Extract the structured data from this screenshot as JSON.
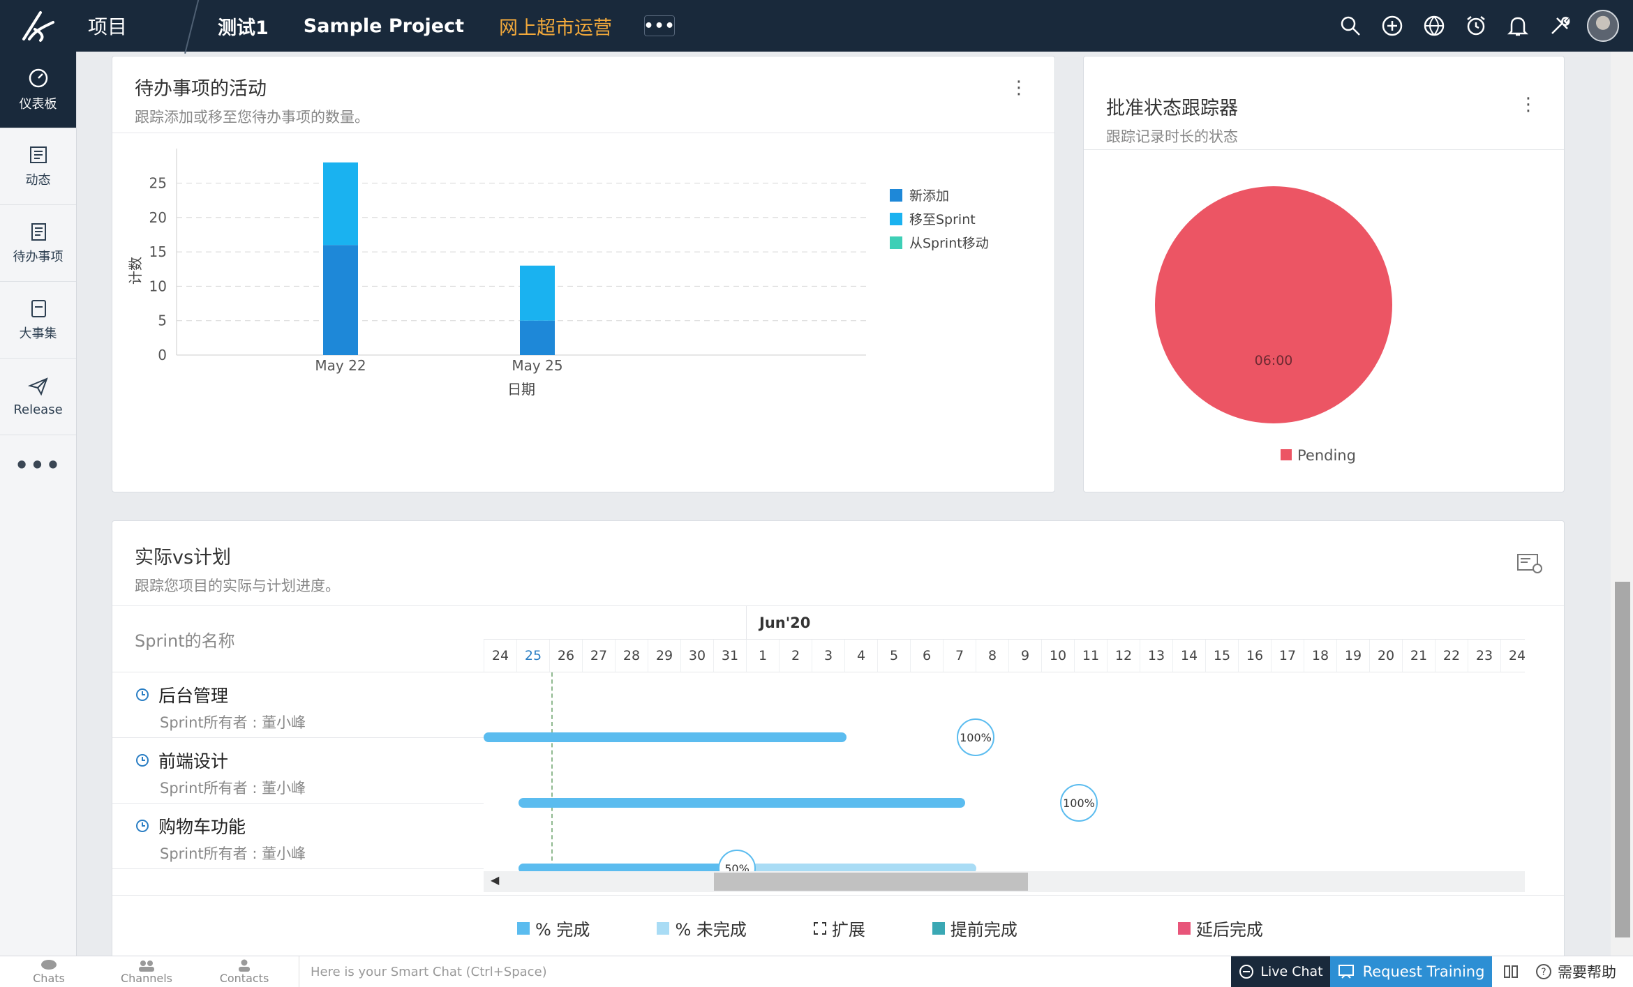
{
  "topbar": {
    "projects_label": "项目",
    "breadcrumbs": [
      "测试1",
      "Sample Project",
      "网上超市运营"
    ],
    "more_label": "•••"
  },
  "sidebar": {
    "items": [
      {
        "label": "仪表板",
        "icon": "dashboard-icon",
        "active": true
      },
      {
        "label": "动态",
        "icon": "feed-icon",
        "active": false
      },
      {
        "label": "待办事项",
        "icon": "backlog-icon",
        "active": false
      },
      {
        "label": "大事集",
        "icon": "epic-icon",
        "active": false
      },
      {
        "label": "Release",
        "icon": "release-icon",
        "active": false
      }
    ],
    "more_label": "•••"
  },
  "backlog_card": {
    "title": "待办事项的活动",
    "subtitle": "跟踪添加或移至您待办事项的数量。"
  },
  "approval_card": {
    "title": "批准状态跟踪器",
    "subtitle": "跟踪记录时长的状态"
  },
  "chart_data": [
    {
      "type": "bar",
      "stacked": true,
      "categories": [
        "May 22",
        "May 25"
      ],
      "series": [
        {
          "name": "新添加",
          "color": "#1e88d8",
          "values": [
            16,
            5
          ]
        },
        {
          "name": "移至Sprint",
          "color": "#1ab2f0",
          "values": [
            12,
            8
          ]
        },
        {
          "name": "从Sprint移动",
          "color": "#3ecfb6",
          "values": [
            0,
            0
          ]
        }
      ],
      "xlabel": "日期",
      "ylabel": "计数",
      "ylim": [
        0,
        29
      ],
      "yticks": [
        "0",
        "5",
        "10",
        "15",
        "20",
        "25"
      ],
      "grid": true,
      "legend": "right"
    },
    {
      "type": "pie",
      "slices": [
        {
          "name": "Pending",
          "value": 100,
          "label": "06:00",
          "color": "#ec5564"
        }
      ],
      "legend": "bottom"
    }
  ],
  "actual_vs_plan": {
    "title": "实际vs计划",
    "subtitle": "跟踪您项目的实际与计划进度。",
    "column_header": "Sprint的名称",
    "month_label": "Jun'20",
    "days": [
      "24",
      "25",
      "26",
      "27",
      "28",
      "29",
      "30",
      "31",
      "1",
      "2",
      "3",
      "4",
      "5",
      "6",
      "7",
      "8",
      "9",
      "10",
      "11",
      "12",
      "13",
      "14",
      "15",
      "16",
      "17",
      "18",
      "19",
      "20",
      "21",
      "22",
      "23",
      "24"
    ],
    "today_index": 1,
    "sprints": [
      {
        "name": "后台管理",
        "owner": "Sprint所有者 : 董小峰",
        "percent": 1.0,
        "percent_label": "100%"
      },
      {
        "name": "前端设计",
        "owner": "Sprint所有者 : 董小峰",
        "percent": 1.0,
        "percent_label": "100%"
      },
      {
        "name": "购物车功能",
        "owner": "Sprint所有者 : 董小峰",
        "percent": 0.5,
        "percent_label": "50%"
      }
    ],
    "legend": [
      {
        "label": "% 完成",
        "color": "#5bbcef",
        "style": "solid"
      },
      {
        "label": "% 未完成",
        "color": "#a9dcf5",
        "style": "solid"
      },
      {
        "label": "扩展",
        "color": "#333333",
        "style": "dashed"
      },
      {
        "label": "提前完成",
        "color": "#3aa8b4",
        "style": "solid"
      },
      {
        "label": "延后完成",
        "color": "#e8557a",
        "style": "solid"
      }
    ]
  },
  "bottombar": {
    "tabs": [
      "Chats",
      "Channels",
      "Contacts"
    ],
    "smart_chat_placeholder": "Here is your Smart Chat (Ctrl+Space)",
    "live_chat": "Live Chat",
    "request_training": "Request Training",
    "help": "需要帮助"
  }
}
